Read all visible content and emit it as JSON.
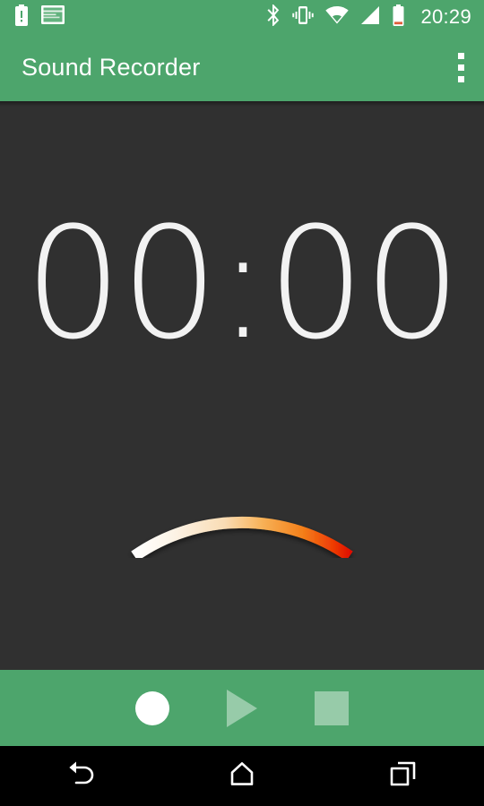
{
  "status_bar": {
    "background": "#4DA56C",
    "left_icons": [
      {
        "name": "battery-alert-icon",
        "label": "Battery alert"
      },
      {
        "name": "screenshot-icon",
        "label": "Screenshot captured"
      }
    ],
    "right_icons": [
      {
        "name": "bluetooth-icon",
        "label": "Bluetooth"
      },
      {
        "name": "vibrate-icon",
        "label": "Vibrate mode"
      },
      {
        "name": "wifi-icon",
        "label": "Wi-Fi"
      },
      {
        "name": "cellular-signal-icon",
        "label": "Cellular signal"
      },
      {
        "name": "battery-icon",
        "label": "Battery low"
      }
    ],
    "clock": "20:29"
  },
  "app_bar": {
    "title": "Sound Recorder",
    "background": "#4DA56C",
    "title_color": "#FFFFFF",
    "overflow_icon": "more-vert-icon"
  },
  "main": {
    "background": "#303030",
    "timer": "00:00",
    "timer_color": "#F2F2F2",
    "meter": {
      "name": "vu-meter-gauge",
      "needle_value": 0,
      "needle_min": 0,
      "needle_max": 100,
      "gradient_stops": [
        "#FFFFFF",
        "#F7E6CF",
        "#F6A73C",
        "#F47216",
        "#E02200"
      ],
      "needle_color": "#D8D8D8",
      "pivot_color": "#FFFFFF"
    }
  },
  "controls": {
    "background": "#4DA56C",
    "buttons": [
      {
        "name": "record-button",
        "icon": "record-circle-icon",
        "label": "Record",
        "enabled": true
      },
      {
        "name": "play-button",
        "icon": "play-triangle-icon",
        "label": "Play",
        "enabled": false
      },
      {
        "name": "stop-button",
        "icon": "stop-square-icon",
        "label": "Stop",
        "enabled": false
      }
    ]
  },
  "nav_bar": {
    "background": "#000000",
    "buttons": [
      {
        "name": "nav-back-button",
        "icon": "back-arrow-icon",
        "label": "Back"
      },
      {
        "name": "nav-home-button",
        "icon": "home-icon",
        "label": "Home"
      },
      {
        "name": "nav-recents-button",
        "icon": "recents-icon",
        "label": "Recent apps"
      }
    ]
  }
}
